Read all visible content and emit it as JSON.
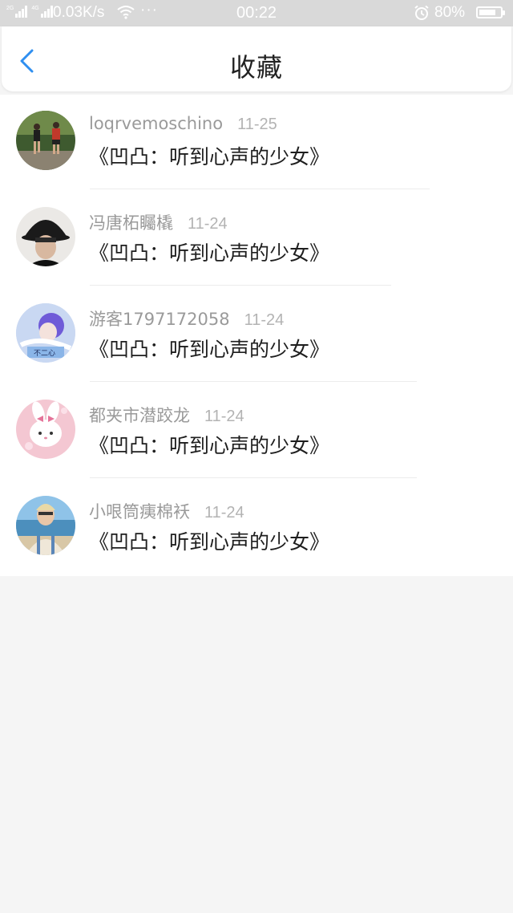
{
  "status_bar": {
    "net_1": "2G",
    "net_2": "4G",
    "speed": "0.03K/s",
    "dots": "···",
    "time": "00:22",
    "battery_percent": "80%",
    "battery_level": 0.8,
    "icons": [
      "signal-icon",
      "wifi-icon",
      "alarm-icon",
      "battery-icon"
    ]
  },
  "header": {
    "title": "收藏",
    "back_icon": "chevron-left-icon",
    "accent_color": "#2f8ff0"
  },
  "favorites": [
    {
      "username": "loqrvemoschino",
      "date": "11-25",
      "content": "《凹凸：听到心声的少女》"
    },
    {
      "username": "冯唐柘矚橇",
      "date": "11-24",
      "content": "《凹凸：听到心声的少女》"
    },
    {
      "username": "游客1797172058",
      "date": "11-24",
      "content": "《凹凸：听到心声的少女》"
    },
    {
      "username": "都夹市潜跤龙",
      "date": "11-24",
      "content": "《凹凸：听到心声的少女》"
    },
    {
      "username": "小哏筒痍棉袄",
      "date": "11-24",
      "content": "《凹凸：听到心声的少女》"
    }
  ]
}
